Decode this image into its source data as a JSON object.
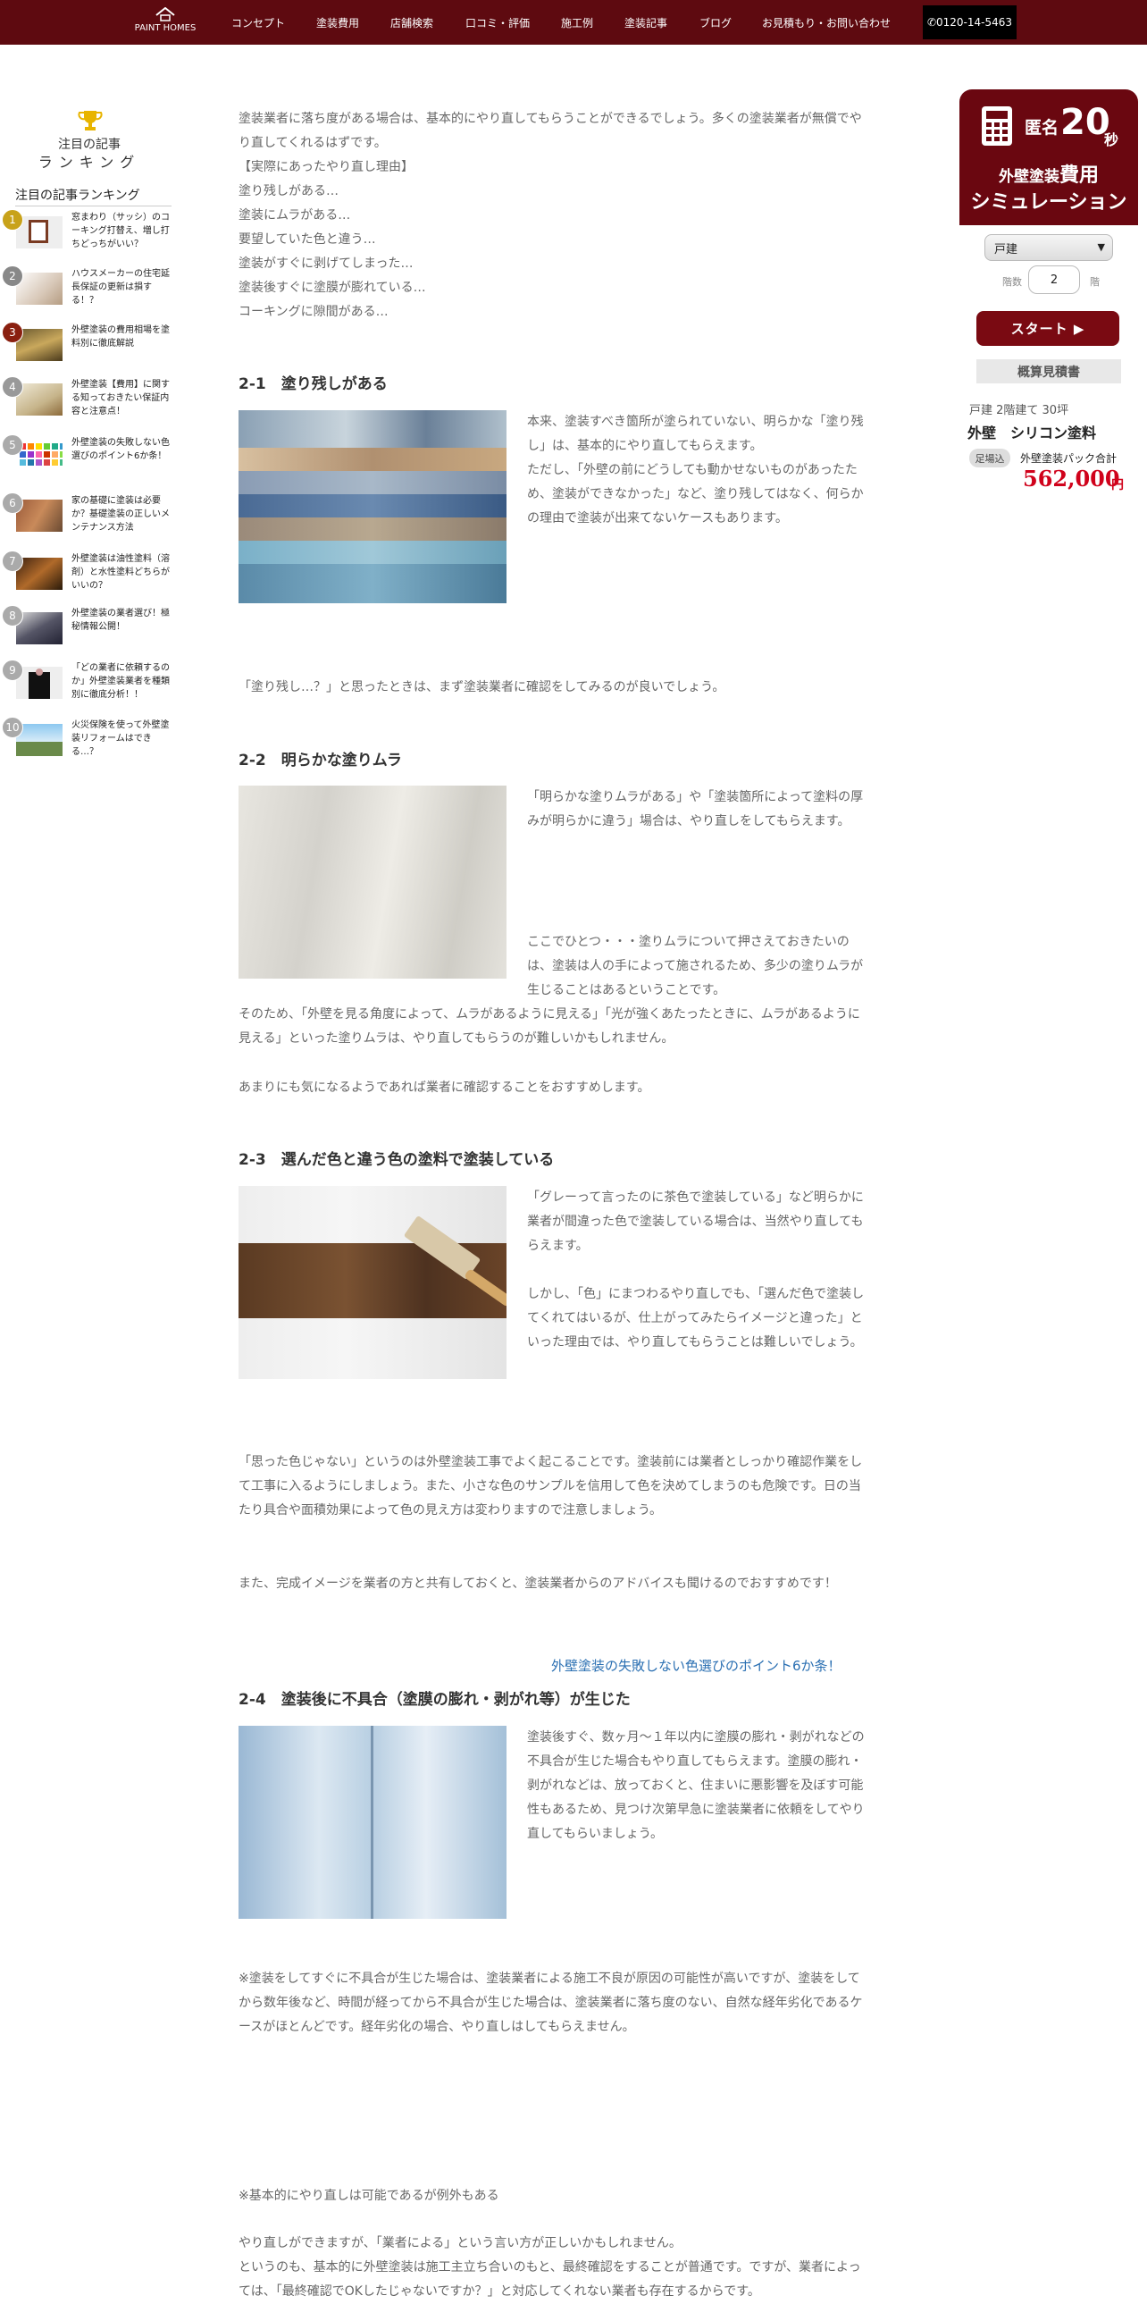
{
  "header": {
    "logo_text": "PAINT HOMES",
    "nav": [
      "コンセプト",
      "塗装費用",
      "店舗検索",
      "口コミ・評価",
      "施工例",
      "塗装記事",
      "ブログ",
      "お見積もり・お問い合わせ"
    ],
    "phone": "0120-14-5463"
  },
  "ranking": {
    "title1": "注目の記事",
    "title2": "ランキング",
    "heading": "注目の記事ランキング",
    "items": [
      {
        "num": "1",
        "text": "窓まわり（サッシ）のコーキング打替え、増し打ちどっちがいい？"
      },
      {
        "num": "2",
        "text": "ハウスメーカーの住宅延長保証の更新は損する！？"
      },
      {
        "num": "3",
        "text": "外壁塗装の費用相場を塗料別に徹底解説"
      },
      {
        "num": "4",
        "text": "外壁塗装【費用】に関する知っておきたい保証内容と注意点！"
      },
      {
        "num": "5",
        "text": "外壁塗装の失敗しない色選びのポイント6か条！"
      },
      {
        "num": "6",
        "text": "家の基礎に塗装は必要か？基礎塗装の正しいメンテナンス方法"
      },
      {
        "num": "7",
        "text": "外壁塗装は油性塗料（溶剤）と水性塗料どちらがいいの？"
      },
      {
        "num": "8",
        "text": "外壁塗装の業者選び！極秘情報公開！"
      },
      {
        "num": "9",
        "text": "「どの業者に依頼するのか」外壁塗装業者を種類別に徹底分析！！"
      },
      {
        "num": "10",
        "text": "火災保険を使って外壁塗装リフォームはできる…？"
      }
    ]
  },
  "article": {
    "intro": [
      "塗装業者に落ち度がある場合は、基本的にやり直してもらうことができるでしょう。多くの塗装業者が無償でやり直してくれるはずです。",
      "【実際にあったやり直し理由】",
      "塗り残しがある…",
      "塗装にムラがある…",
      "要望していた色と違う…",
      "塗装がすぐに剥げてしまった…",
      "塗装後すぐに塗膜が膨れている…",
      "コーキングに隙間がある…"
    ],
    "s1_title": "2-1　塗り残しがある",
    "s1_text": "本来、塗装すべき箇所が塗られていない、明らかな「塗り残し」は、基本的にやり直してもらえます。\nただし、「外壁の前にどうしても動かせないものがあったため、塗装ができなかった」など、塗り残してはなく、何らかの理由で塗装が出来てないケースもあります。",
    "s1_after": "「塗り残し…？」と思ったときは、まず塗装業者に確認をしてみるのが良いでしょう。",
    "s2_title": "2-2　明らかな塗りムラ",
    "s2_text1": "「明らかな塗りムラがある」や「塗装箇所によって塗料の厚みが明らかに違う」場合は、やり直しをしてもらえます。",
    "s2_text2": "ここでひとつ・・・塗りムラについて押さえておきたいのは、塗装は人の手によって施されるため、多少の塗りムラが生じることはあるということです。",
    "s2_after1": "そのため、「外壁を見る角度によって、ムラがあるように見える」「光が強くあたったときに、ムラがあるように見える」といった塗りムラは、やり直してもらうのが難しいかもしれません。",
    "s2_after2": "あまりにも気になるようであれば業者に確認することをおすすめします。",
    "s3_title": "2-3　選んだ色と違う色の塗料で塗装している",
    "s3_text1": "「グレーって言ったのに茶色で塗装している」など明らかに業者が間違った色で塗装している場合は、当然やり直してもらえます。",
    "s3_text2": "しかし、「色」にまつわるやり直しでも、「選んだ色で塗装してくれてはいるが、仕上がってみたらイメージと違った」といった理由では、やり直してもらうことは難しいでしょう。",
    "s3_after1": "「思った色じゃない」というのは外壁塗装工事でよく起こることです。塗装前には業者としっかり確認作業をして工事に入るようにしましょう。また、小さな色のサンプルを信用して色を決めてしまうのも危険です。日の当たり具合や面積効果によって色の見え方は変わりますので注意しましょう。",
    "s3_after2": "また、完成イメージを業者の方と共有しておくと、塗装業者からのアドバイスも聞けるのでおすすめです！",
    "link": "外壁塗装の失敗しない色選びのポイント6か条！",
    "s4_title": "2-4　塗装後に不具合（塗膜の膨れ・剥がれ等）が生じた",
    "s4_text": "塗装後すぐ、数ヶ月～１年以内に塗膜の膨れ・剥がれなどの不具合が生じた場合もやり直してもらえます。塗膜の膨れ・剥がれなどは、放っておくと、住まいに悪影響を及ぼす可能性もあるため、見つけ次第早急に塗装業者に依頼をしてやり直してもらいましょう。",
    "s4_after": "※塗装をしてすぐに不具合が生じた場合は、塗装業者による施工不良が原因の可能性が高いですが、塗装をしてから数年後など、時間が経ってから不具合が生じた場合は、塗装業者に落ち度のない、自然な経年劣化であるケースがほとんどです。経年劣化の場合、やり直しはしてもらえません。",
    "note1": "※基本的にやり直しは可能であるが例外もある",
    "note2": "やり直しができますが、「業者による」という言い方が正しいかもしれません。",
    "note3": "というのも、基本的に外壁塗装は施工主立ち合いのもと、最終確認をすることが普通です。ですが、業者によっては、「最終確認でOKしたじゃないですか？」と対応してくれない業者も存在するからです。"
  },
  "simulator": {
    "anon": "匿名",
    "num": "20",
    "sec": "秒",
    "line2a": "外壁塗装",
    "line2b": "費用",
    "line3": "シミュレーション",
    "select_value": "戸建",
    "floors_label": "階数",
    "floors_value": "2",
    "floors_unit": "階",
    "start": "スタート ▶",
    "estimate": "概算見積書",
    "house": "戸建 2階建て 30坪",
    "paint": "外壁　シリコン塗料",
    "badge": "足場込",
    "pack": "外壁塗装パック合計",
    "price": "562,000",
    "yen": "円"
  }
}
